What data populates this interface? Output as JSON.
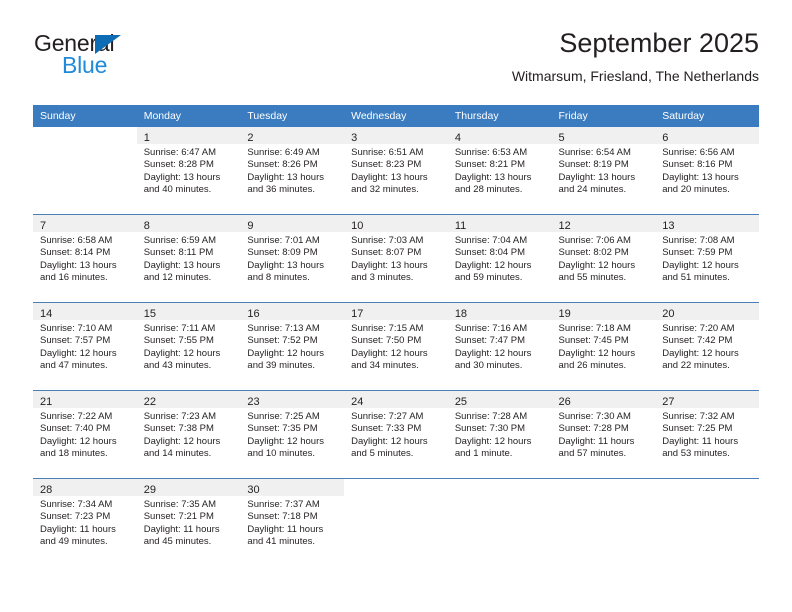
{
  "brand": {
    "word1": "General",
    "word2": "Blue",
    "triangle_color": "#0d6cb3",
    "word2_color": "#2089d8"
  },
  "header": {
    "title": "September 2025",
    "subtitle": "Witmarsum, Friesland, The Netherlands"
  },
  "theme": {
    "header_bg": "#3b7cc0",
    "header_text": "#ffffff",
    "daynum_band_bg": "#f0f0f0",
    "row_border": "#4a80b5",
    "text": "#231f20"
  },
  "weekday_headers": [
    "Sunday",
    "Monday",
    "Tuesday",
    "Wednesday",
    "Thursday",
    "Friday",
    "Saturday"
  ],
  "weeks": [
    [
      {
        "day": "",
        "lines": []
      },
      {
        "day": "1",
        "lines": [
          "Sunrise: 6:47 AM",
          "Sunset: 8:28 PM",
          "Daylight: 13 hours",
          "and 40 minutes."
        ]
      },
      {
        "day": "2",
        "lines": [
          "Sunrise: 6:49 AM",
          "Sunset: 8:26 PM",
          "Daylight: 13 hours",
          "and 36 minutes."
        ]
      },
      {
        "day": "3",
        "lines": [
          "Sunrise: 6:51 AM",
          "Sunset: 8:23 PM",
          "Daylight: 13 hours",
          "and 32 minutes."
        ]
      },
      {
        "day": "4",
        "lines": [
          "Sunrise: 6:53 AM",
          "Sunset: 8:21 PM",
          "Daylight: 13 hours",
          "and 28 minutes."
        ]
      },
      {
        "day": "5",
        "lines": [
          "Sunrise: 6:54 AM",
          "Sunset: 8:19 PM",
          "Daylight: 13 hours",
          "and 24 minutes."
        ]
      },
      {
        "day": "6",
        "lines": [
          "Sunrise: 6:56 AM",
          "Sunset: 8:16 PM",
          "Daylight: 13 hours",
          "and 20 minutes."
        ]
      }
    ],
    [
      {
        "day": "7",
        "lines": [
          "Sunrise: 6:58 AM",
          "Sunset: 8:14 PM",
          "Daylight: 13 hours",
          "and 16 minutes."
        ]
      },
      {
        "day": "8",
        "lines": [
          "Sunrise: 6:59 AM",
          "Sunset: 8:11 PM",
          "Daylight: 13 hours",
          "and 12 minutes."
        ]
      },
      {
        "day": "9",
        "lines": [
          "Sunrise: 7:01 AM",
          "Sunset: 8:09 PM",
          "Daylight: 13 hours",
          "and 8 minutes."
        ]
      },
      {
        "day": "10",
        "lines": [
          "Sunrise: 7:03 AM",
          "Sunset: 8:07 PM",
          "Daylight: 13 hours",
          "and 3 minutes."
        ]
      },
      {
        "day": "11",
        "lines": [
          "Sunrise: 7:04 AM",
          "Sunset: 8:04 PM",
          "Daylight: 12 hours",
          "and 59 minutes."
        ]
      },
      {
        "day": "12",
        "lines": [
          "Sunrise: 7:06 AM",
          "Sunset: 8:02 PM",
          "Daylight: 12 hours",
          "and 55 minutes."
        ]
      },
      {
        "day": "13",
        "lines": [
          "Sunrise: 7:08 AM",
          "Sunset: 7:59 PM",
          "Daylight: 12 hours",
          "and 51 minutes."
        ]
      }
    ],
    [
      {
        "day": "14",
        "lines": [
          "Sunrise: 7:10 AM",
          "Sunset: 7:57 PM",
          "Daylight: 12 hours",
          "and 47 minutes."
        ]
      },
      {
        "day": "15",
        "lines": [
          "Sunrise: 7:11 AM",
          "Sunset: 7:55 PM",
          "Daylight: 12 hours",
          "and 43 minutes."
        ]
      },
      {
        "day": "16",
        "lines": [
          "Sunrise: 7:13 AM",
          "Sunset: 7:52 PM",
          "Daylight: 12 hours",
          "and 39 minutes."
        ]
      },
      {
        "day": "17",
        "lines": [
          "Sunrise: 7:15 AM",
          "Sunset: 7:50 PM",
          "Daylight: 12 hours",
          "and 34 minutes."
        ]
      },
      {
        "day": "18",
        "lines": [
          "Sunrise: 7:16 AM",
          "Sunset: 7:47 PM",
          "Daylight: 12 hours",
          "and 30 minutes."
        ]
      },
      {
        "day": "19",
        "lines": [
          "Sunrise: 7:18 AM",
          "Sunset: 7:45 PM",
          "Daylight: 12 hours",
          "and 26 minutes."
        ]
      },
      {
        "day": "20",
        "lines": [
          "Sunrise: 7:20 AM",
          "Sunset: 7:42 PM",
          "Daylight: 12 hours",
          "and 22 minutes."
        ]
      }
    ],
    [
      {
        "day": "21",
        "lines": [
          "Sunrise: 7:22 AM",
          "Sunset: 7:40 PM",
          "Daylight: 12 hours",
          "and 18 minutes."
        ]
      },
      {
        "day": "22",
        "lines": [
          "Sunrise: 7:23 AM",
          "Sunset: 7:38 PM",
          "Daylight: 12 hours",
          "and 14 minutes."
        ]
      },
      {
        "day": "23",
        "lines": [
          "Sunrise: 7:25 AM",
          "Sunset: 7:35 PM",
          "Daylight: 12 hours",
          "and 10 minutes."
        ]
      },
      {
        "day": "24",
        "lines": [
          "Sunrise: 7:27 AM",
          "Sunset: 7:33 PM",
          "Daylight: 12 hours",
          "and 5 minutes."
        ]
      },
      {
        "day": "25",
        "lines": [
          "Sunrise: 7:28 AM",
          "Sunset: 7:30 PM",
          "Daylight: 12 hours",
          "and 1 minute."
        ]
      },
      {
        "day": "26",
        "lines": [
          "Sunrise: 7:30 AM",
          "Sunset: 7:28 PM",
          "Daylight: 11 hours",
          "and 57 minutes."
        ]
      },
      {
        "day": "27",
        "lines": [
          "Sunrise: 7:32 AM",
          "Sunset: 7:25 PM",
          "Daylight: 11 hours",
          "and 53 minutes."
        ]
      }
    ],
    [
      {
        "day": "28",
        "lines": [
          "Sunrise: 7:34 AM",
          "Sunset: 7:23 PM",
          "Daylight: 11 hours",
          "and 49 minutes."
        ]
      },
      {
        "day": "29",
        "lines": [
          "Sunrise: 7:35 AM",
          "Sunset: 7:21 PM",
          "Daylight: 11 hours",
          "and 45 minutes."
        ]
      },
      {
        "day": "30",
        "lines": [
          "Sunrise: 7:37 AM",
          "Sunset: 7:18 PM",
          "Daylight: 11 hours",
          "and 41 minutes."
        ]
      },
      {
        "day": "",
        "lines": []
      },
      {
        "day": "",
        "lines": []
      },
      {
        "day": "",
        "lines": []
      },
      {
        "day": "",
        "lines": []
      }
    ]
  ]
}
